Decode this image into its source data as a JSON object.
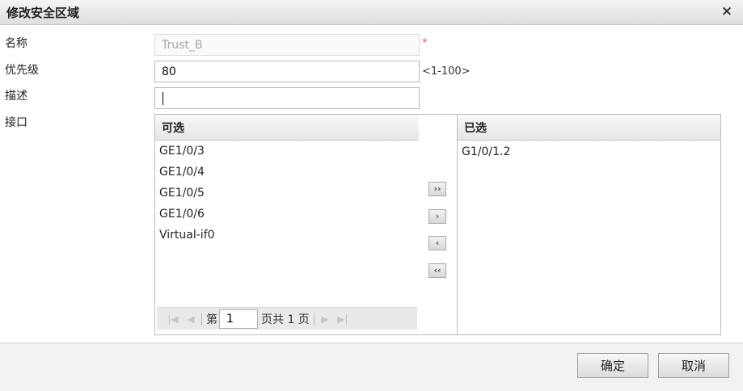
{
  "dialog": {
    "title": "修改安全区域",
    "close_glyph": "×"
  },
  "form": {
    "name": {
      "label": "名称",
      "value": "Trust_B",
      "required_mark": "*"
    },
    "priority": {
      "label": "优先级",
      "value": "80",
      "range_hint": "<1-100>"
    },
    "description": {
      "label": "描述",
      "value": ""
    },
    "interfaces": {
      "label": "接口"
    }
  },
  "available": {
    "header": "可选",
    "items": [
      "GE1/0/3",
      "GE1/0/4",
      "GE1/0/5",
      "GE1/0/6",
      "Virtual-if0"
    ]
  },
  "selected": {
    "header": "已选",
    "items": [
      "G1/0/1.2"
    ]
  },
  "pager": {
    "page_prefix": "第",
    "current_page": "1",
    "page_suffix": "页共 1 页"
  },
  "move_buttons": {
    "add_all": "››",
    "add": "›",
    "remove": "‹",
    "remove_all": "‹‹"
  },
  "footer": {
    "ok_label": "确定",
    "cancel_label": "取消"
  }
}
